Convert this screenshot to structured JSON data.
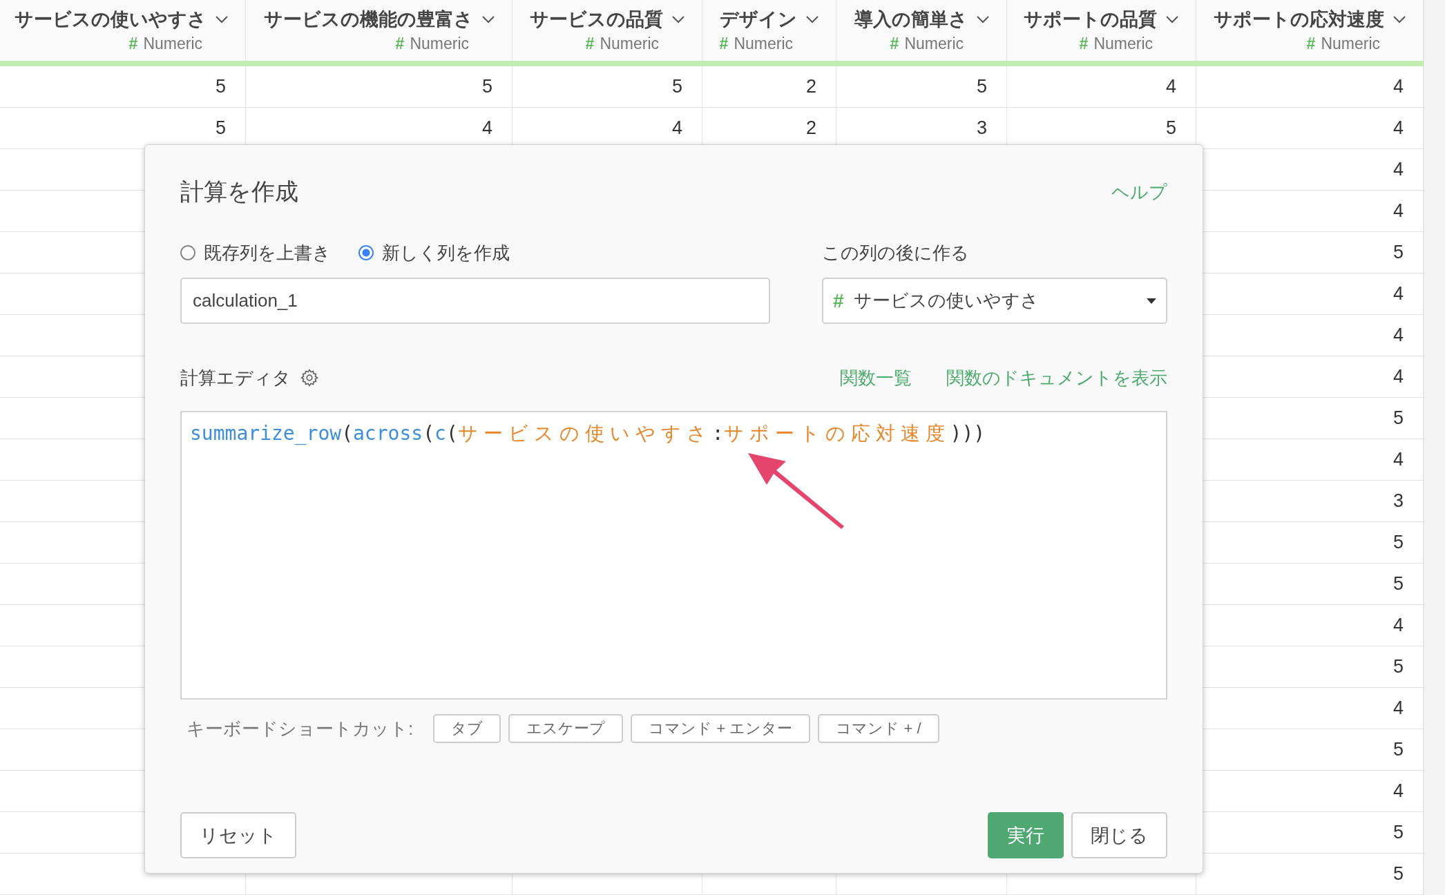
{
  "table": {
    "columns": [
      {
        "name": "サービスの使いやすさ",
        "type_icon": "#",
        "type": "Numeric"
      },
      {
        "name": "サービスの機能の豊富さ",
        "type_icon": "#",
        "type": "Numeric"
      },
      {
        "name": "サービスの品質",
        "type_icon": "#",
        "type": "Numeric"
      },
      {
        "name": "デザイン",
        "type_icon": "#",
        "type": "Numeric"
      },
      {
        "name": "導入の簡単さ",
        "type_icon": "#",
        "type": "Numeric"
      },
      {
        "name": "サポートの品質",
        "type_icon": "#",
        "type": "Numeric"
      },
      {
        "name": "サポートの応対速度",
        "type_icon": "#",
        "type": "Numeric"
      }
    ],
    "rows": [
      {
        "cells": [
          "5",
          "5",
          "5",
          "2",
          "5",
          "4",
          "4"
        ]
      },
      {
        "cells": [
          "5",
          "4",
          "4",
          "2",
          "3",
          "5",
          "4"
        ]
      },
      {
        "cells": [
          null,
          null,
          null,
          null,
          null,
          null,
          "4"
        ]
      },
      {
        "cells": [
          null,
          null,
          null,
          null,
          null,
          null,
          "4"
        ]
      },
      {
        "cells": [
          null,
          null,
          null,
          null,
          null,
          null,
          "5"
        ]
      },
      {
        "cells": [
          null,
          null,
          null,
          null,
          null,
          null,
          "4"
        ]
      },
      {
        "cells": [
          null,
          null,
          null,
          null,
          null,
          null,
          "4"
        ]
      },
      {
        "cells": [
          null,
          null,
          null,
          null,
          null,
          null,
          "4"
        ]
      },
      {
        "cells": [
          null,
          null,
          null,
          null,
          null,
          null,
          "5"
        ]
      },
      {
        "cells": [
          null,
          null,
          null,
          null,
          null,
          null,
          "4"
        ]
      },
      {
        "cells": [
          null,
          null,
          null,
          null,
          null,
          null,
          "3"
        ]
      },
      {
        "cells": [
          null,
          null,
          null,
          null,
          null,
          null,
          "5"
        ]
      },
      {
        "cells": [
          null,
          null,
          null,
          null,
          null,
          null,
          "5"
        ]
      },
      {
        "cells": [
          null,
          null,
          null,
          null,
          null,
          null,
          "4"
        ]
      },
      {
        "cells": [
          null,
          null,
          null,
          null,
          null,
          null,
          "5"
        ]
      },
      {
        "cells": [
          null,
          null,
          null,
          null,
          null,
          null,
          "4"
        ]
      },
      {
        "cells": [
          null,
          null,
          null,
          null,
          null,
          null,
          "5"
        ]
      },
      {
        "cells": [
          null,
          null,
          null,
          null,
          null,
          null,
          "4"
        ]
      },
      {
        "cells": [
          null,
          null,
          null,
          null,
          null,
          null,
          "5"
        ]
      },
      {
        "cells": [
          null,
          null,
          null,
          null,
          null,
          null,
          "5"
        ]
      }
    ]
  },
  "dialog": {
    "title": "計算を作成",
    "help_link": "ヘルプ",
    "modes": [
      {
        "label": "既存列を上書き",
        "selected": false
      },
      {
        "label": "新しく列を作成",
        "selected": true
      }
    ],
    "column_name": {
      "value": "calculation_1"
    },
    "position": {
      "label": "この列の後に作る",
      "type_icon": "#",
      "value": "サービスの使いやすさ"
    },
    "editor": {
      "label": "計算エディタ",
      "links": [
        "関数一覧",
        "関数のドキュメントを表示"
      ],
      "code": [
        {
          "kind": "function",
          "text": "summarize_row"
        },
        {
          "kind": "punct",
          "text": "("
        },
        {
          "kind": "function",
          "text": "across"
        },
        {
          "kind": "punct",
          "text": "("
        },
        {
          "kind": "function",
          "text": "c"
        },
        {
          "kind": "punct",
          "text": "("
        },
        {
          "kind": "column",
          "text": "サービスの使いやすさ"
        },
        {
          "kind": "punct",
          "text": ":"
        },
        {
          "kind": "column",
          "text": "サポートの応対速度"
        },
        {
          "kind": "punct",
          "text": ")))"
        }
      ]
    },
    "shortcuts": {
      "label": "キーボードショートカット:",
      "keys": [
        "タブ",
        "エスケープ",
        "コマンド + エンター",
        "コマンド + /"
      ]
    },
    "buttons": [
      {
        "label": "リセット",
        "kind": "default"
      },
      {
        "label": "実行",
        "kind": "primary"
      },
      {
        "label": "閉じる",
        "kind": "default"
      }
    ]
  }
}
